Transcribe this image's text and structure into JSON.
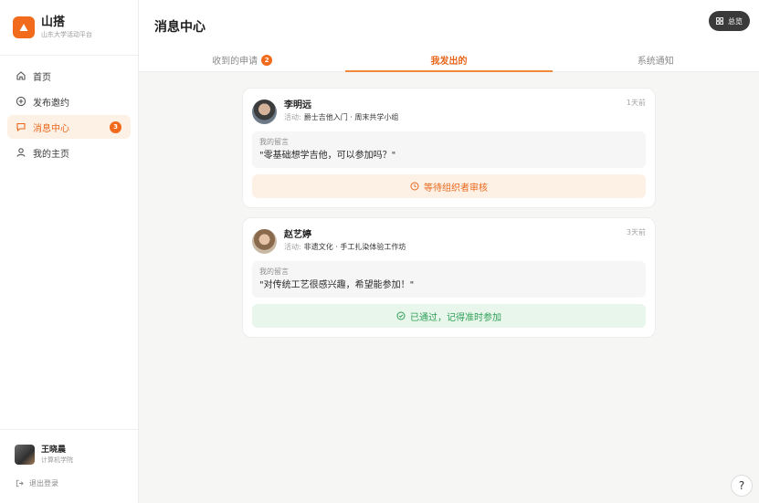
{
  "brand": {
    "name": "山搭",
    "subtitle": "山东大学活动平台",
    "color": "#f26a1b"
  },
  "nav": [
    {
      "label": "首页",
      "icon": "home-icon"
    },
    {
      "label": "发布邀约",
      "icon": "plus-circle-icon"
    },
    {
      "label": "消息中心",
      "icon": "chat-icon",
      "badge": "3",
      "active": true
    },
    {
      "label": "我的主页",
      "icon": "user-icon"
    }
  ],
  "user": {
    "name": "王晓晨",
    "dept": "计算机学院"
  },
  "logout_label": "退出登录",
  "header": {
    "title": "消息中心",
    "overview_label": "总览"
  },
  "tabs": [
    {
      "label": "收到的申请",
      "badge": "2"
    },
    {
      "label": "我发出的",
      "active": true
    },
    {
      "label": "系统通知"
    }
  ],
  "cards": [
    {
      "name": "李明远",
      "activity_label": "活动:",
      "activity": "爵士吉他入门 · 周末共学小组",
      "time": "1天前",
      "message_label": "我的留言",
      "message": "\"零基础想学吉他，可以参加吗？\"",
      "status": "等待组织者审核",
      "status_type": "pending"
    },
    {
      "name": "赵艺婷",
      "activity_label": "活动:",
      "activity": "非遗文化 · 手工扎染体验工作坊",
      "time": "3天前",
      "message_label": "我的留言",
      "message": "\"对传统工艺很感兴趣，希望能参加！\"",
      "status": "已通过，记得准时参加",
      "status_type": "approved"
    }
  ],
  "help_label": "?"
}
